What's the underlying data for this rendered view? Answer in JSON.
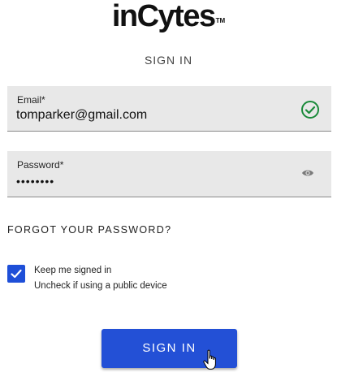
{
  "brand": {
    "logo_text": "inCytes",
    "trademark": "TM"
  },
  "page": {
    "title": "SIGN IN"
  },
  "email": {
    "label": "Email*",
    "value": "tomparker@gmail.com",
    "status_icon": "check-circle-icon",
    "status_color": "#1a8a3a"
  },
  "password": {
    "label": "Password*",
    "value": "••••••••",
    "toggle_icon": "eye-icon"
  },
  "forgot_link": "FORGOT YOUR PASSWORD?",
  "keep_signed_in": {
    "checked": true,
    "label": "Keep me signed in",
    "hint": "Uncheck if using a public device"
  },
  "submit": {
    "label": "SIGN IN",
    "color": "#2350d6"
  },
  "pointer": "hand-cursor-icon"
}
